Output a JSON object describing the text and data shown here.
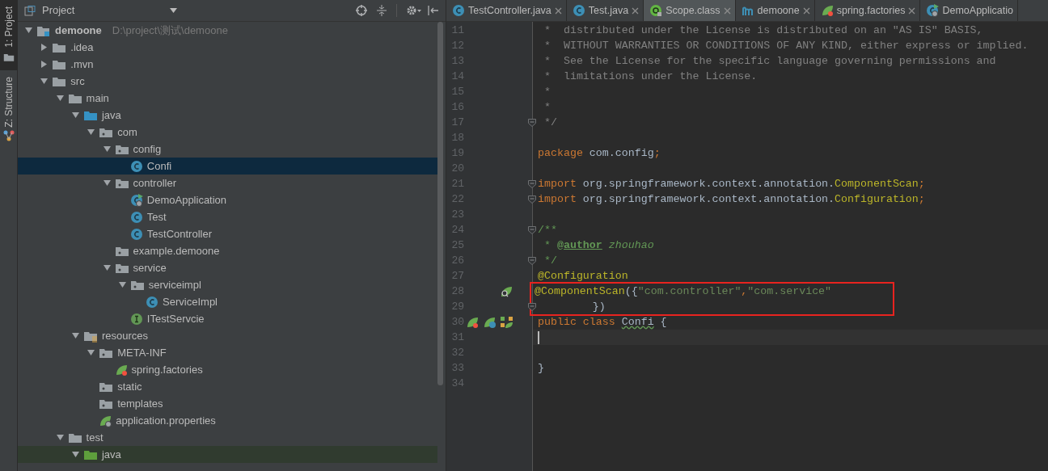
{
  "side_strip": [
    {
      "label": "1: Project",
      "selected": true,
      "kind": "project"
    },
    {
      "label": "Z: Structure",
      "selected": false,
      "kind": "structure"
    }
  ],
  "project_panel": {
    "title": "Project",
    "tree": [
      {
        "label": "demoone",
        "hint": "D:\\project\\测试\\demoone",
        "kind": "module",
        "expanded": true,
        "selected": false,
        "children": [
          {
            "label": ".idea",
            "kind": "folder",
            "expanded": false,
            "selected": false
          },
          {
            "label": ".mvn",
            "kind": "folder",
            "expanded": false,
            "selected": false
          },
          {
            "label": "src",
            "kind": "folder",
            "expanded": true,
            "selected": false,
            "children": [
              {
                "label": "main",
                "kind": "folder",
                "expanded": true,
                "selected": false,
                "children": [
                  {
                    "label": "java",
                    "kind": "source",
                    "expanded": true,
                    "selected": false,
                    "children": [
                      {
                        "label": "com",
                        "kind": "package",
                        "expanded": true,
                        "selected": false,
                        "children": [
                          {
                            "label": "config",
                            "kind": "package",
                            "expanded": true,
                            "selected": false,
                            "children": [
                              {
                                "label": "Confi",
                                "kind": "class",
                                "selected": true
                              }
                            ]
                          },
                          {
                            "label": "controller",
                            "kind": "package",
                            "expanded": true,
                            "selected": false,
                            "children": [
                              {
                                "label": "DemoApplication",
                                "kind": "boot-class",
                                "selected": false
                              },
                              {
                                "label": "Test",
                                "kind": "class",
                                "selected": false
                              },
                              {
                                "label": "TestController",
                                "kind": "class",
                                "selected": false
                              }
                            ]
                          },
                          {
                            "label": "example.demoone",
                            "kind": "package",
                            "selected": false
                          },
                          {
                            "label": "service",
                            "kind": "package",
                            "expanded": true,
                            "selected": false,
                            "children": [
                              {
                                "label": "serviceimpl",
                                "kind": "package",
                                "expanded": true,
                                "selected": false,
                                "children": [
                                  {
                                    "label": "ServiceImpl",
                                    "kind": "class",
                                    "selected": false
                                  }
                                ]
                              },
                              {
                                "label": "ITestServcie",
                                "kind": "interface",
                                "selected": false
                              }
                            ]
                          }
                        ]
                      }
                    ]
                  },
                  {
                    "label": "resources",
                    "kind": "resources",
                    "expanded": true,
                    "selected": false,
                    "children": [
                      {
                        "label": "META-INF",
                        "kind": "package",
                        "expanded": true,
                        "selected": false,
                        "children": [
                          {
                            "label": "spring.factories",
                            "kind": "spring-file",
                            "selected": false
                          }
                        ]
                      },
                      {
                        "label": "static",
                        "kind": "package",
                        "selected": false
                      },
                      {
                        "label": "templates",
                        "kind": "package",
                        "selected": false
                      },
                      {
                        "label": "application.properties",
                        "kind": "boot-file",
                        "selected": false
                      }
                    ]
                  }
                ]
              },
              {
                "label": "test",
                "kind": "folder",
                "expanded": true,
                "selected": false,
                "children": [
                  {
                    "label": "java",
                    "kind": "test-source",
                    "expanded": true,
                    "selected": false
                  }
                ]
              }
            ]
          }
        ]
      }
    ]
  },
  "editor": {
    "tabs": [
      {
        "label": "TestController.java",
        "kind": "class",
        "selected": false
      },
      {
        "label": "Test.java",
        "kind": "class",
        "selected": false
      },
      {
        "label": "Scope.class",
        "kind": "annotation",
        "selected": true
      },
      {
        "label": "demoone",
        "kind": "maven",
        "selected": false
      },
      {
        "label": "spring.factories",
        "kind": "spring-file",
        "selected": false
      },
      {
        "label": "DemoApplicatio",
        "kind": "boot-class",
        "selected": false
      }
    ],
    "lines": [
      {
        "number": "11",
        "tokens": [
          {
            "text": " *  distributed under the License is distributed on an \"AS IS\" BASIS,",
            "kind": "comment"
          }
        ]
      },
      {
        "number": "12",
        "tokens": [
          {
            "text": " *  WITHOUT WARRANTIES OR CONDITIONS OF ANY KIND, either express or implied.",
            "kind": "comment"
          }
        ]
      },
      {
        "number": "13",
        "tokens": [
          {
            "text": " *  See the License for the specific language governing permissions and",
            "kind": "comment"
          }
        ]
      },
      {
        "number": "14",
        "tokens": [
          {
            "text": " *  limitations under the License.",
            "kind": "comment"
          }
        ]
      },
      {
        "number": "15",
        "tokens": [
          {
            "text": " *",
            "kind": "comment"
          }
        ]
      },
      {
        "number": "16",
        "tokens": [
          {
            "text": " *",
            "kind": "comment"
          }
        ]
      },
      {
        "number": "17",
        "fold": true,
        "tokens": [
          {
            "text": " */",
            "kind": "comment"
          }
        ]
      },
      {
        "number": "18"
      },
      {
        "number": "19",
        "tokens": [
          {
            "text": "package",
            "kind": "keyword"
          },
          {
            "text": " com.config",
            "kind": "plain"
          },
          {
            "text": ";",
            "kind": "keyword"
          }
        ]
      },
      {
        "number": "20"
      },
      {
        "number": "21",
        "fold": true,
        "tokens": [
          {
            "text": "import",
            "kind": "keyword"
          },
          {
            "text": " org.springframework.context.annotation.",
            "kind": "plain"
          },
          {
            "text": "ComponentScan",
            "kind": "annotation"
          },
          {
            "text": ";",
            "kind": "keyword"
          }
        ]
      },
      {
        "number": "22",
        "fold": true,
        "tokens": [
          {
            "text": "import",
            "kind": "keyword"
          },
          {
            "text": " org.springframework.context.annotation.",
            "kind": "plain"
          },
          {
            "text": "Configuration",
            "kind": "annotation"
          },
          {
            "text": ";",
            "kind": "keyword"
          }
        ]
      },
      {
        "number": "23"
      },
      {
        "number": "24",
        "fold": true,
        "tokens": [
          {
            "text": "/**",
            "kind": "doc"
          }
        ]
      },
      {
        "number": "25",
        "tokens": [
          {
            "text": " * ",
            "kind": "doc"
          },
          {
            "text": "@author",
            "kind": "doctag"
          },
          {
            "text": " zhouhao",
            "kind": "docitalic"
          }
        ]
      },
      {
        "number": "26",
        "fold": true,
        "tokens": [
          {
            "text": " */",
            "kind": "doc"
          }
        ]
      },
      {
        "number": "27",
        "tokens": [
          {
            "text": "@Configuration",
            "kind": "annotation"
          }
        ]
      },
      {
        "number": "28",
        "boxed": true,
        "gutter_icons": [
          {
            "kind": "leaf-search"
          }
        ],
        "tokens": [
          {
            "text": "@ComponentScan",
            "kind": "annotation"
          },
          {
            "text": "({",
            "kind": "plain"
          },
          {
            "text": "\"com.controller\"",
            "kind": "string"
          },
          {
            "text": ",",
            "kind": "keyword"
          },
          {
            "text": "\"com.service\"",
            "kind": "string"
          }
        ]
      },
      {
        "number": "29",
        "boxed": true,
        "fold": true,
        "tokens": [
          {
            "text": "         })",
            "kind": "plain"
          }
        ]
      },
      {
        "number": "30",
        "gutter_icons": [
          {
            "kind": "leaf-star"
          },
          {
            "kind": "leaf-class"
          },
          {
            "kind": "leaf-diagram"
          }
        ],
        "tokens": [
          {
            "text": "public class ",
            "kind": "keyword"
          },
          {
            "text": "Confi",
            "kind": "typo"
          },
          {
            "text": " {",
            "kind": "plain"
          }
        ]
      },
      {
        "number": "31",
        "current": true
      },
      {
        "number": "32"
      },
      {
        "number": "33",
        "tokens": [
          {
            "text": "}",
            "kind": "plain"
          }
        ]
      },
      {
        "number": "34"
      }
    ]
  }
}
